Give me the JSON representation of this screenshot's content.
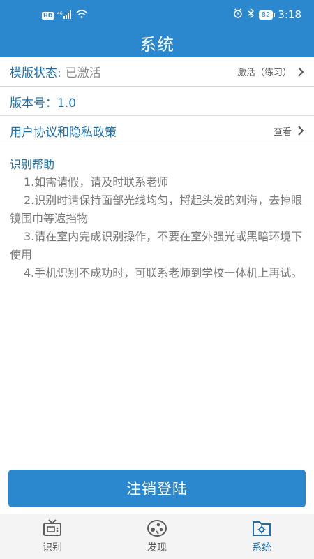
{
  "statusbar": {
    "hd": "HD",
    "signal": "⁴⁶",
    "battery": "82",
    "time": "3:18"
  },
  "header": {
    "title": "系统"
  },
  "rows": {
    "template_status_label": "模版状态:",
    "template_status_value": "已激活",
    "template_status_action": "激活（练习）",
    "version_label": "版本号：1.0",
    "agreement_label": "用户协议和隐私政策",
    "agreement_action": "查看"
  },
  "help": {
    "title": "识别帮助",
    "items": [
      "1.如需请假，请及时联系老师",
      "2.识别时请保持面部光线均匀，捋起头发的刘海，去掉眼镜围巾等遮挡物",
      "3.请在室内完成识别操作，不要在室外强光或黑暗环境下使用",
      "4.手机识别不成功时，可联系老师到学校一体机上再试。"
    ]
  },
  "logout_label": "注销登陆",
  "tabs": [
    {
      "label": "识别",
      "icon": "tv-icon"
    },
    {
      "label": "发现",
      "icon": "discover-icon"
    },
    {
      "label": "系统",
      "icon": "folder-gear-icon"
    }
  ],
  "colors": {
    "primary": "#2b87ce",
    "accent_text": "#1f6fad"
  }
}
